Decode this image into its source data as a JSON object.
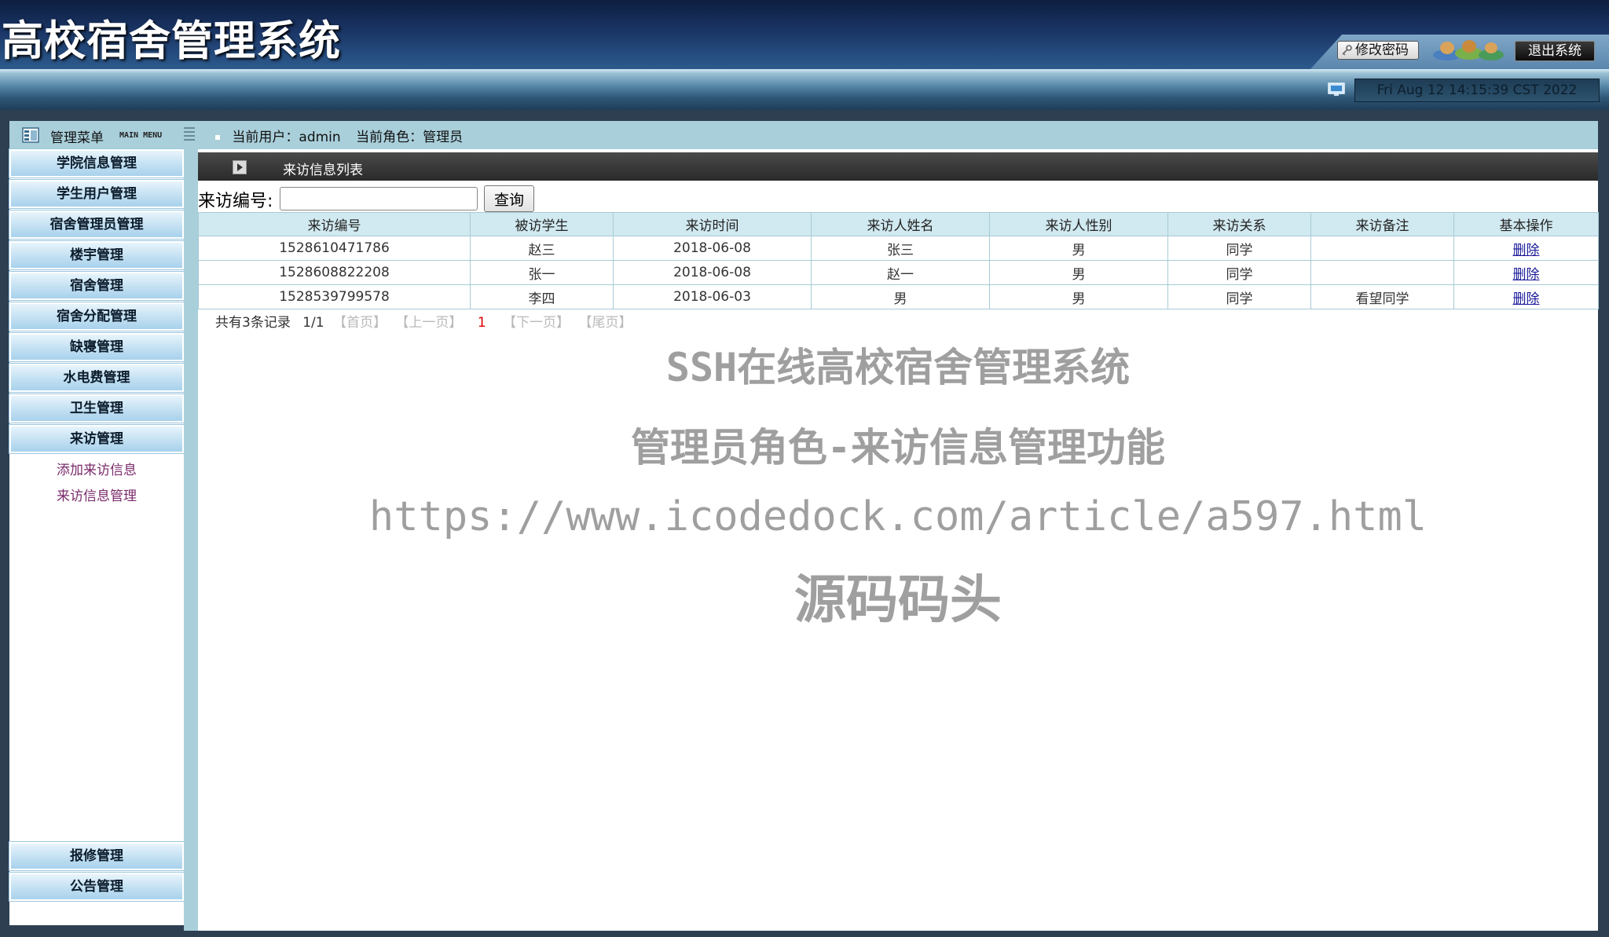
{
  "header": {
    "app_title": "高校宿舍管理系统",
    "change_password_label": "修改密码",
    "logout_label": "退出系统",
    "datetime": "Fri Aug 12 14:15:39 CST 2022"
  },
  "sidebar": {
    "title": "管理菜单",
    "subtitle": "MAIN MENU",
    "items": [
      {
        "label": "学院信息管理"
      },
      {
        "label": "学生用户管理"
      },
      {
        "label": "宿舍管理员管理"
      },
      {
        "label": "楼宇管理"
      },
      {
        "label": "宿舍管理"
      },
      {
        "label": "宿舍分配管理"
      },
      {
        "label": "缺寝管理"
      },
      {
        "label": "水电费管理"
      },
      {
        "label": "卫生管理"
      },
      {
        "label": "来访管理"
      }
    ],
    "sub_links": [
      "添加来访信息",
      "来访信息管理"
    ],
    "bottom_items": [
      {
        "label": "报修管理"
      },
      {
        "label": "公告管理"
      }
    ]
  },
  "topbar": {
    "current_user": "当前用户：admin",
    "current_role": "当前角色：管理员"
  },
  "panel": {
    "title": "来访信息列表"
  },
  "search": {
    "label": "来访编号:",
    "value": "",
    "button_label": "查询"
  },
  "table": {
    "columns": [
      "来访编号",
      "被访学生",
      "来访时间",
      "来访人姓名",
      "来访人性别",
      "来访关系",
      "来访备注",
      "基本操作"
    ],
    "rows": [
      [
        "1528610471786",
        "赵三",
        "2018-06-08",
        "张三",
        "男",
        "同学",
        "",
        "删除"
      ],
      [
        "1528608822208",
        "张一",
        "2018-06-08",
        "赵一",
        "男",
        "同学",
        "",
        "删除"
      ],
      [
        "1528539799578",
        "李四",
        "2018-06-03",
        "男",
        "男",
        "同学",
        "看望同学",
        "删除"
      ]
    ]
  },
  "pager": {
    "summary": "共有3条记录",
    "page_of": "1/1",
    "first": "【首页】",
    "prev": "【上一页】",
    "current": "1",
    "next": "【下一页】",
    "last": "【尾页】"
  },
  "watermark": {
    "line1": "SSH在线高校宿舍管理系统",
    "line2": "管理员角色-来访信息管理功能",
    "line3": "https://www.icodedock.com/article/a597.html",
    "line4": "源码码头"
  }
}
